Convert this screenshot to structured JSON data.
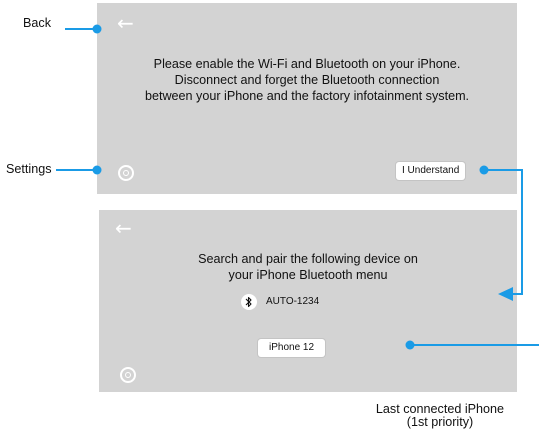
{
  "callouts": {
    "back": "Back",
    "settings": "Settings",
    "last_connected_line1": "Last connected iPhone",
    "last_connected_line2": "(1st priority)"
  },
  "screen1": {
    "back_icon": "←",
    "message_line1": "Please enable the Wi-Fi and Bluetooth on your iPhone.",
    "message_line2": "Disconnect and forget the Bluetooth connection",
    "message_line3": "between your iPhone and the factory infotainment system.",
    "understand_button": "I Understand"
  },
  "screen2": {
    "back_icon": "←",
    "message_line1": "Search and pair the following device on",
    "message_line2": "your  iPhone Bluetooth menu",
    "device_name": "AUTO-1234",
    "phone_button": "iPhone 12"
  },
  "colors": {
    "screen_bg": "#d3d3d3",
    "callout_blue": "#1a9be6"
  },
  "icons": [
    "back-arrow-icon",
    "settings-icon",
    "bluetooth-icon"
  ]
}
